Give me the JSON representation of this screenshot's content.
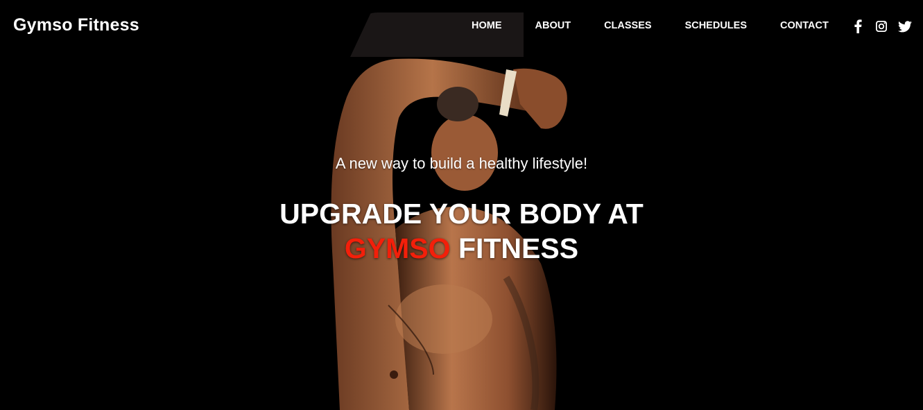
{
  "brand": {
    "name": "Gymso Fitness"
  },
  "nav": {
    "items": [
      {
        "label": "HOME"
      },
      {
        "label": "ABOUT"
      },
      {
        "label": "CLASSES"
      },
      {
        "label": "SCHEDULES"
      },
      {
        "label": "CONTACT"
      }
    ],
    "social": [
      {
        "icon": "facebook-icon"
      },
      {
        "icon": "instagram-icon"
      },
      {
        "icon": "twitter-icon"
      }
    ]
  },
  "hero": {
    "tagline": "A new way to build a healthy lifestyle!",
    "headline_line1": "UPGRADE YOUR BODY AT",
    "headline_accent": "GYMSO",
    "headline_end": "FITNESS",
    "background_image": "muscular-man-stretching-photo"
  },
  "colors": {
    "background": "#000000",
    "accent": "#f31f0a",
    "text": "#ffffff"
  }
}
